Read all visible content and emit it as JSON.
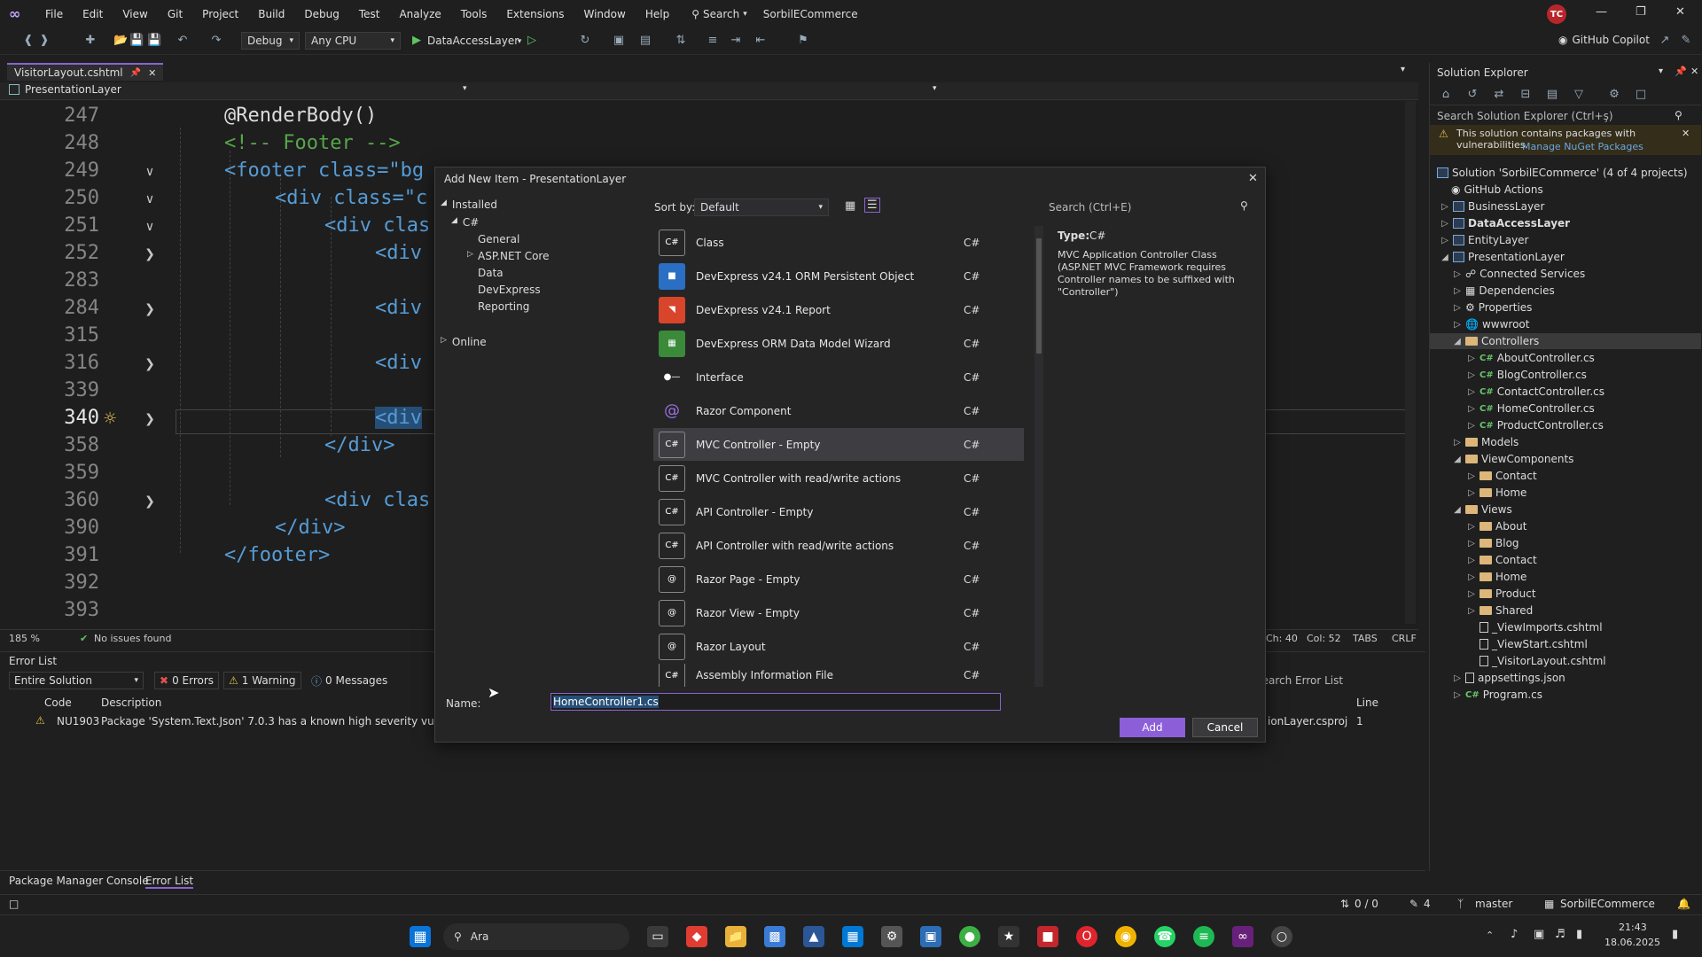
{
  "menubar": {
    "items": [
      "File",
      "Edit",
      "View",
      "Git",
      "Project",
      "Build",
      "Debug",
      "Test",
      "Analyze",
      "Tools",
      "Extensions",
      "Window",
      "Help"
    ],
    "search_label": "Search",
    "solution_title": "SorbilECommerce",
    "avatar": "TC"
  },
  "toolbar": {
    "config": "Debug",
    "platform": "Any CPU",
    "startup_project": "DataAccessLayer",
    "copilot_label": "GitHub Copilot"
  },
  "editor": {
    "tab_label": "VisitorLayout.cshtml",
    "nav_project": "PresentationLayer",
    "lines": [
      {
        "no": "247",
        "code": "@RenderBody()"
      },
      {
        "no": "248",
        "code": "<!-- Footer -->"
      },
      {
        "no": "249",
        "code": "<footer class=\"bg"
      },
      {
        "no": "250",
        "code": "<div class=\"c"
      },
      {
        "no": "251",
        "code": "<div clas"
      },
      {
        "no": "252",
        "code": "<div"
      },
      {
        "no": "283",
        "code": ""
      },
      {
        "no": "284",
        "code": "<div"
      },
      {
        "no": "315",
        "code": ""
      },
      {
        "no": "316",
        "code": "<div"
      },
      {
        "no": "339",
        "code": ""
      },
      {
        "no": "340",
        "code": "<div"
      },
      {
        "no": "358",
        "code": "</div>"
      },
      {
        "no": "359",
        "code": ""
      },
      {
        "no": "360",
        "code": "<div clas"
      },
      {
        "no": "390",
        "code": "</div>"
      },
      {
        "no": "391",
        "code": "</footer>"
      },
      {
        "no": "392",
        "code": ""
      },
      {
        "no": "393",
        "code": ""
      }
    ],
    "zoom": "185 %",
    "issues": "No issues found",
    "cursor": "Ch: 40",
    "col": "Col: 52",
    "indent": "TABS",
    "eol": "CRLF"
  },
  "error_list": {
    "title": "Error List",
    "scope": "Entire Solution",
    "errors": "0 Errors",
    "warnings": "1 Warning",
    "messages": "0 Messages",
    "search_placeholder": "Search Error List",
    "columns": {
      "code": "Code",
      "description": "Description",
      "line": "Line"
    },
    "rows": [
      {
        "code": "NU1903",
        "description": "Package 'System.Text.Json' 7.0.3 has a known high severity vulnerability,",
        "project": "ionLayer.csproj",
        "line": "1"
      }
    ]
  },
  "bottom_tabs": [
    "Package Manager Console",
    "Error List"
  ],
  "statusbar": {
    "changes": "0 / 0",
    "edits": "4",
    "branch": "master",
    "solution": "SorbilECommerce"
  },
  "dialog": {
    "title": "Add New Item - PresentationLayer",
    "installed": "Installed",
    "csharp": "C#",
    "categories": [
      "General",
      "ASP.NET Core",
      "Data",
      "DevExpress",
      "Reporting"
    ],
    "online": "Online",
    "sort_by_label": "Sort by:",
    "sort_by_value": "Default",
    "search_placeholder": "Search (Ctrl+E)",
    "templates": [
      {
        "name": "Class",
        "lang": "C#"
      },
      {
        "name": "DevExpress v24.1 ORM Persistent Object",
        "lang": "C#"
      },
      {
        "name": "DevExpress v24.1 Report",
        "lang": "C#"
      },
      {
        "name": "DevExpress ORM Data Model Wizard",
        "lang": "C#"
      },
      {
        "name": "Interface",
        "lang": "C#"
      },
      {
        "name": "Razor Component",
        "lang": "C#"
      },
      {
        "name": "MVC Controller - Empty",
        "lang": "C#"
      },
      {
        "name": "MVC Controller with read/write actions",
        "lang": "C#"
      },
      {
        "name": "API Controller - Empty",
        "lang": "C#"
      },
      {
        "name": "API Controller with read/write actions",
        "lang": "C#"
      },
      {
        "name": "Razor Page - Empty",
        "lang": "C#"
      },
      {
        "name": "Razor View - Empty",
        "lang": "C#"
      },
      {
        "name": "Razor Layout",
        "lang": "C#"
      },
      {
        "name": "Assembly Information File",
        "lang": "C#"
      }
    ],
    "type_label": "Type:",
    "type_value": "C#",
    "description": "MVC Application Controller Class (ASP.NET MVC Framework requires Controller names to be suffixed with \"Controller\")",
    "name_label": "Name:",
    "name_value": "HomeController1.cs",
    "add_label": "Add",
    "cancel_label": "Cancel"
  },
  "solution_explorer": {
    "title": "Solution Explorer",
    "search_placeholder": "Search Solution Explorer (Ctrl+ş)",
    "warning_text": "This solution contains packages with vulnerabilities.",
    "warning_link": "Manage NuGet Packages",
    "solution_label": "Solution 'SorbilECommerce' (4 of 4 projects)",
    "items": [
      "GitHub Actions",
      "BusinessLayer",
      "DataAccessLayer",
      "EntityLayer",
      "PresentationLayer",
      "Connected Services",
      "Dependencies",
      "Properties",
      "wwwroot",
      "Controllers",
      "AboutController.cs",
      "BlogController.cs",
      "ContactController.cs",
      "HomeController.cs",
      "ProductController.cs",
      "Models",
      "ViewComponents",
      "Contact",
      "Home",
      "Views",
      "About",
      "Blog",
      "Contact",
      "Home",
      "Product",
      "Shared",
      "_ViewImports.cshtml",
      "_ViewStart.cshtml",
      "_VisitorLayout.cshtml",
      "appsettings.json",
      "Program.cs"
    ]
  },
  "taskbar": {
    "search_label": "Ara",
    "time": "21:43",
    "date": "18.06.2025"
  },
  "colors": {
    "accent": "#8a63d2",
    "selection": "#264f78",
    "add_button": "#8c5fd9"
  }
}
